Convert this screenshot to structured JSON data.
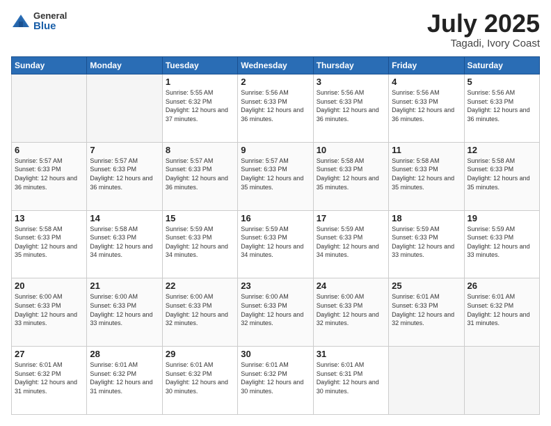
{
  "logo": {
    "general": "General",
    "blue": "Blue"
  },
  "header": {
    "month": "July 2025",
    "location": "Tagadi, Ivory Coast"
  },
  "weekdays": [
    "Sunday",
    "Monday",
    "Tuesday",
    "Wednesday",
    "Thursday",
    "Friday",
    "Saturday"
  ],
  "weeks": [
    [
      {
        "day": "",
        "empty": true
      },
      {
        "day": "",
        "empty": true
      },
      {
        "day": "1",
        "sunrise": "5:55 AM",
        "sunset": "6:32 PM",
        "daylight": "12 hours and 37 minutes."
      },
      {
        "day": "2",
        "sunrise": "5:56 AM",
        "sunset": "6:33 PM",
        "daylight": "12 hours and 36 minutes."
      },
      {
        "day": "3",
        "sunrise": "5:56 AM",
        "sunset": "6:33 PM",
        "daylight": "12 hours and 36 minutes."
      },
      {
        "day": "4",
        "sunrise": "5:56 AM",
        "sunset": "6:33 PM",
        "daylight": "12 hours and 36 minutes."
      },
      {
        "day": "5",
        "sunrise": "5:56 AM",
        "sunset": "6:33 PM",
        "daylight": "12 hours and 36 minutes."
      }
    ],
    [
      {
        "day": "6",
        "sunrise": "5:57 AM",
        "sunset": "6:33 PM",
        "daylight": "12 hours and 36 minutes."
      },
      {
        "day": "7",
        "sunrise": "5:57 AM",
        "sunset": "6:33 PM",
        "daylight": "12 hours and 36 minutes."
      },
      {
        "day": "8",
        "sunrise": "5:57 AM",
        "sunset": "6:33 PM",
        "daylight": "12 hours and 36 minutes."
      },
      {
        "day": "9",
        "sunrise": "5:57 AM",
        "sunset": "6:33 PM",
        "daylight": "12 hours and 35 minutes."
      },
      {
        "day": "10",
        "sunrise": "5:58 AM",
        "sunset": "6:33 PM",
        "daylight": "12 hours and 35 minutes."
      },
      {
        "day": "11",
        "sunrise": "5:58 AM",
        "sunset": "6:33 PM",
        "daylight": "12 hours and 35 minutes."
      },
      {
        "day": "12",
        "sunrise": "5:58 AM",
        "sunset": "6:33 PM",
        "daylight": "12 hours and 35 minutes."
      }
    ],
    [
      {
        "day": "13",
        "sunrise": "5:58 AM",
        "sunset": "6:33 PM",
        "daylight": "12 hours and 35 minutes."
      },
      {
        "day": "14",
        "sunrise": "5:58 AM",
        "sunset": "6:33 PM",
        "daylight": "12 hours and 34 minutes."
      },
      {
        "day": "15",
        "sunrise": "5:59 AM",
        "sunset": "6:33 PM",
        "daylight": "12 hours and 34 minutes."
      },
      {
        "day": "16",
        "sunrise": "5:59 AM",
        "sunset": "6:33 PM",
        "daylight": "12 hours and 34 minutes."
      },
      {
        "day": "17",
        "sunrise": "5:59 AM",
        "sunset": "6:33 PM",
        "daylight": "12 hours and 34 minutes."
      },
      {
        "day": "18",
        "sunrise": "5:59 AM",
        "sunset": "6:33 PM",
        "daylight": "12 hours and 33 minutes."
      },
      {
        "day": "19",
        "sunrise": "5:59 AM",
        "sunset": "6:33 PM",
        "daylight": "12 hours and 33 minutes."
      }
    ],
    [
      {
        "day": "20",
        "sunrise": "6:00 AM",
        "sunset": "6:33 PM",
        "daylight": "12 hours and 33 minutes."
      },
      {
        "day": "21",
        "sunrise": "6:00 AM",
        "sunset": "6:33 PM",
        "daylight": "12 hours and 33 minutes."
      },
      {
        "day": "22",
        "sunrise": "6:00 AM",
        "sunset": "6:33 PM",
        "daylight": "12 hours and 32 minutes."
      },
      {
        "day": "23",
        "sunrise": "6:00 AM",
        "sunset": "6:33 PM",
        "daylight": "12 hours and 32 minutes."
      },
      {
        "day": "24",
        "sunrise": "6:00 AM",
        "sunset": "6:33 PM",
        "daylight": "12 hours and 32 minutes."
      },
      {
        "day": "25",
        "sunrise": "6:01 AM",
        "sunset": "6:33 PM",
        "daylight": "12 hours and 32 minutes."
      },
      {
        "day": "26",
        "sunrise": "6:01 AM",
        "sunset": "6:32 PM",
        "daylight": "12 hours and 31 minutes."
      }
    ],
    [
      {
        "day": "27",
        "sunrise": "6:01 AM",
        "sunset": "6:32 PM",
        "daylight": "12 hours and 31 minutes."
      },
      {
        "day": "28",
        "sunrise": "6:01 AM",
        "sunset": "6:32 PM",
        "daylight": "12 hours and 31 minutes."
      },
      {
        "day": "29",
        "sunrise": "6:01 AM",
        "sunset": "6:32 PM",
        "daylight": "12 hours and 30 minutes."
      },
      {
        "day": "30",
        "sunrise": "6:01 AM",
        "sunset": "6:32 PM",
        "daylight": "12 hours and 30 minutes."
      },
      {
        "day": "31",
        "sunrise": "6:01 AM",
        "sunset": "6:31 PM",
        "daylight": "12 hours and 30 minutes."
      },
      {
        "day": "",
        "empty": true
      },
      {
        "day": "",
        "empty": true
      }
    ]
  ],
  "labels": {
    "sunrise": "Sunrise:",
    "sunset": "Sunset:",
    "daylight": "Daylight:"
  }
}
